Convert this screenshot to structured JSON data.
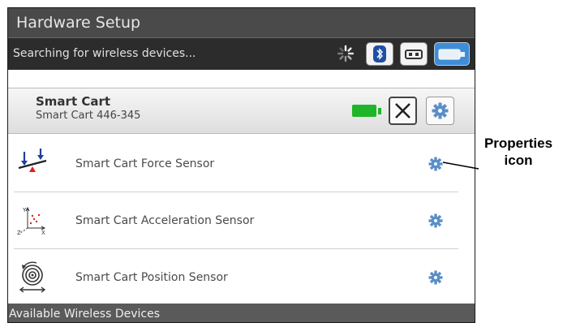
{
  "window": {
    "title": "Hardware Setup"
  },
  "search": {
    "status": "Searching for wireless devices..."
  },
  "toolbar": {
    "icons": [
      "spinner-icon",
      "bluetooth-icon",
      "usb-icon",
      "cable-icon"
    ]
  },
  "device": {
    "name": "Smart Cart",
    "id": "Smart Cart 446-345",
    "battery_color": "#1fb528"
  },
  "sensors": [
    {
      "label": "Smart Cart Force Sensor",
      "icon": "force-sensor-icon"
    },
    {
      "label": "Smart Cart Acceleration Sensor",
      "icon": "acceleration-sensor-icon"
    },
    {
      "label": "Smart Cart Position Sensor",
      "icon": "position-sensor-icon"
    }
  ],
  "footer": {
    "label": "Available Wireless Devices"
  },
  "annotation": {
    "line1": "Properties",
    "line2": "icon"
  },
  "colors": {
    "accent": "#3f8dd6",
    "gear": "#5a8ec8"
  }
}
